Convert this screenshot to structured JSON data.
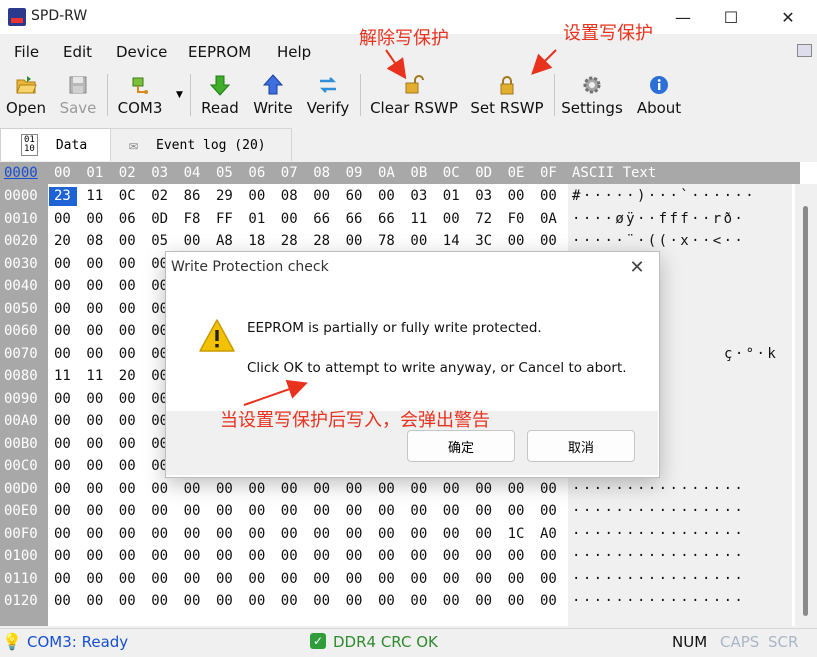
{
  "window": {
    "title": "SPD-RW",
    "controls": {
      "minimize": "—",
      "maximize": "☐",
      "close": "✕"
    }
  },
  "menu": {
    "items": [
      "File",
      "Edit",
      "Device",
      "EEPROM",
      "Help"
    ]
  },
  "toolbar": {
    "open": "Open",
    "save": "Save",
    "port": "COM3",
    "read": "Read",
    "write": "Write",
    "verify": "Verify",
    "clear_rswp": "Clear RSWP",
    "set_rswp": "Set RSWP",
    "settings": "Settings",
    "about": "About"
  },
  "tabs": {
    "data": "Data",
    "events": "Event log (20)"
  },
  "grid": {
    "header_offset": "0000",
    "columns": [
      "00",
      "01",
      "02",
      "03",
      "04",
      "05",
      "06",
      "07",
      "08",
      "09",
      "0A",
      "0B",
      "0C",
      "0D",
      "0E",
      "0F"
    ],
    "ascii_header": "ASCII Text",
    "rows": [
      {
        "off": "0000",
        "hex": [
          "23",
          "11",
          "0C",
          "02",
          "86",
          "29",
          "00",
          "08",
          "00",
          "60",
          "00",
          "03",
          "01",
          "03",
          "00",
          "00"
        ],
        "ascii": "#·····)···`······"
      },
      {
        "off": "0010",
        "hex": [
          "00",
          "00",
          "06",
          "0D",
          "F8",
          "FF",
          "01",
          "00",
          "66",
          "66",
          "66",
          "11",
          "00",
          "72",
          "F0",
          "0A"
        ],
        "ascii": "····øÿ··fff··rð·"
      },
      {
        "off": "0020",
        "hex": [
          "20",
          "08",
          "00",
          "05",
          "00",
          "A8",
          "18",
          "28",
          "28",
          "00",
          "78",
          "00",
          "14",
          "3C",
          "00",
          "00"
        ],
        "ascii": "·····¨·((·x··<··"
      },
      {
        "off": "0030",
        "hex": [
          "00",
          "00",
          "00",
          "00",
          "",
          "",
          "",
          "",
          "",
          "",
          "",
          "",
          "",
          "",
          "",
          ""
        ],
        "ascii": ""
      },
      {
        "off": "0040",
        "hex": [
          "00",
          "00",
          "00",
          "00",
          "",
          "",
          "",
          "",
          "",
          "",
          "",
          "",
          "",
          "",
          "",
          ""
        ],
        "ascii": ""
      },
      {
        "off": "0050",
        "hex": [
          "00",
          "00",
          "00",
          "00",
          "",
          "",
          "",
          "",
          "",
          "",
          "",
          "",
          "",
          "",
          "",
          ""
        ],
        "ascii": ""
      },
      {
        "off": "0060",
        "hex": [
          "00",
          "00",
          "00",
          "00",
          "",
          "",
          "",
          "",
          "",
          "",
          "",
          "",
          "",
          "",
          "",
          ""
        ],
        "ascii": ""
      },
      {
        "off": "0070",
        "hex": [
          "00",
          "00",
          "00",
          "00",
          "",
          "",
          "",
          "",
          "",
          "",
          "",
          "",
          "",
          "",
          "",
          ""
        ],
        "ascii": "ç·°·k"
      },
      {
        "off": "0080",
        "hex": [
          "11",
          "11",
          "20",
          "00",
          "",
          "",
          "",
          "",
          "",
          "",
          "",
          "",
          "",
          "",
          "",
          ""
        ],
        "ascii": ""
      },
      {
        "off": "0090",
        "hex": [
          "00",
          "00",
          "00",
          "00",
          "",
          "",
          "",
          "",
          "",
          "",
          "",
          "",
          "",
          "",
          "",
          ""
        ],
        "ascii": ""
      },
      {
        "off": "00A0",
        "hex": [
          "00",
          "00",
          "00",
          "00",
          "",
          "",
          "",
          "",
          "",
          "",
          "",
          "",
          "",
          "",
          "",
          ""
        ],
        "ascii": ""
      },
      {
        "off": "00B0",
        "hex": [
          "00",
          "00",
          "00",
          "00",
          "",
          "",
          "",
          "",
          "",
          "",
          "",
          "",
          "",
          "",
          "",
          ""
        ],
        "ascii": ""
      },
      {
        "off": "00C0",
        "hex": [
          "00",
          "00",
          "00",
          "00",
          "",
          "",
          "",
          "",
          "",
          "",
          "",
          "",
          "",
          "",
          "",
          ""
        ],
        "ascii": ""
      },
      {
        "off": "00D0",
        "hex": [
          "00",
          "00",
          "00",
          "00",
          "00",
          "00",
          "00",
          "00",
          "00",
          "00",
          "00",
          "00",
          "00",
          "00",
          "00",
          "00"
        ],
        "ascii": "················"
      },
      {
        "off": "00E0",
        "hex": [
          "00",
          "00",
          "00",
          "00",
          "00",
          "00",
          "00",
          "00",
          "00",
          "00",
          "00",
          "00",
          "00",
          "00",
          "00",
          "00"
        ],
        "ascii": "················"
      },
      {
        "off": "00F0",
        "hex": [
          "00",
          "00",
          "00",
          "00",
          "00",
          "00",
          "00",
          "00",
          "00",
          "00",
          "00",
          "00",
          "00",
          "00",
          "1C",
          "A0"
        ],
        "ascii": "················"
      },
      {
        "off": "0100",
        "hex": [
          "00",
          "00",
          "00",
          "00",
          "00",
          "00",
          "00",
          "00",
          "00",
          "00",
          "00",
          "00",
          "00",
          "00",
          "00",
          "00"
        ],
        "ascii": "················"
      },
      {
        "off": "0110",
        "hex": [
          "00",
          "00",
          "00",
          "00",
          "00",
          "00",
          "00",
          "00",
          "00",
          "00",
          "00",
          "00",
          "00",
          "00",
          "00",
          "00"
        ],
        "ascii": "················"
      },
      {
        "off": "0120",
        "hex": [
          "00",
          "00",
          "00",
          "00",
          "00",
          "00",
          "00",
          "00",
          "00",
          "00",
          "00",
          "00",
          "00",
          "00",
          "00",
          "00"
        ],
        "ascii": "················"
      }
    ]
  },
  "dialog": {
    "title": "Write Protection check",
    "line1": "EEPROM is partially or fully write protected.",
    "line2": "Click OK to attempt to write anyway, or Cancel to abort.",
    "ok": "确定",
    "cancel": "取消"
  },
  "annotations": {
    "clear": "解除写保护",
    "set": "设置写保护",
    "warning": "当设置写保护后写入，会弹出警告",
    "color": "#e8321e"
  },
  "status": {
    "port": "COM3: Ready",
    "crc": "DDR4 CRC OK",
    "num": "NUM",
    "caps": "CAPS",
    "scr": "SCR"
  }
}
